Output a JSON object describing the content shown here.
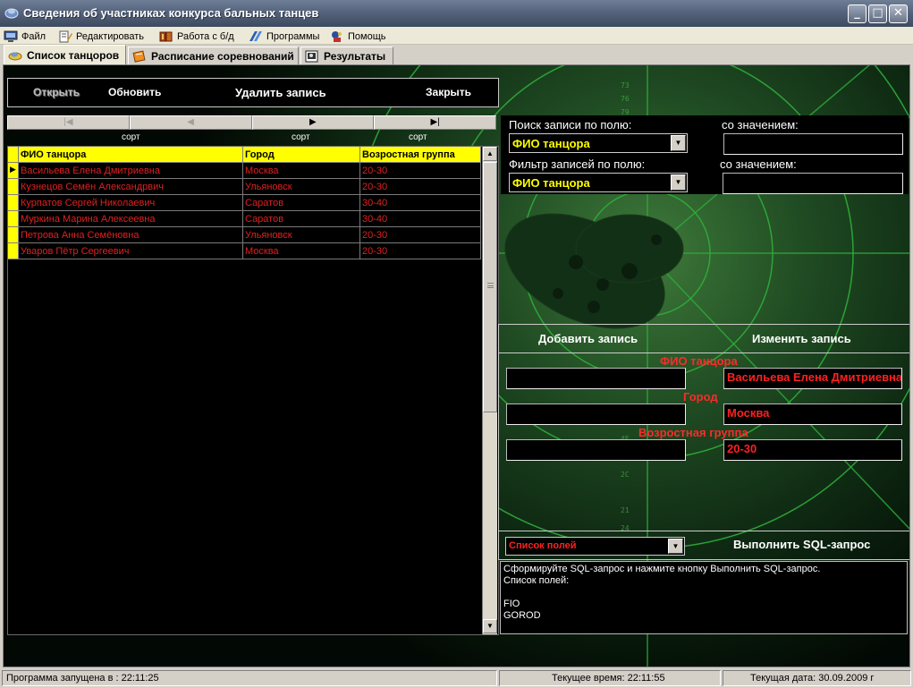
{
  "window": {
    "title": "Сведения об участниках конкурса бальных танцев",
    "minimize_label": "_",
    "maximize_label": "□",
    "close_label": "✕"
  },
  "menu": [
    {
      "label": "Файл",
      "icon": "computer-icon"
    },
    {
      "label": "Редактировать",
      "icon": "edit-icon"
    },
    {
      "label": "Работа с б/д",
      "icon": "database-book-icon"
    },
    {
      "label": "Программы",
      "icon": "programs-icon"
    },
    {
      "label": "Помощь",
      "icon": "help-icon"
    }
  ],
  "tabs": [
    {
      "label": "Список танцоров",
      "icon": "dancers-icon",
      "active": true
    },
    {
      "label": "Расписание соревнований",
      "icon": "schedule-icon",
      "active": false
    },
    {
      "label": "Результаты",
      "icon": "results-icon",
      "active": false
    }
  ],
  "toolbar": {
    "open_label": "Открыть",
    "refresh_label": "Обновить",
    "delete_label": "Удалить запись",
    "close_label": "Закрыть"
  },
  "navigator": {
    "first_label": "|◀",
    "prior_label": "◀",
    "next_label": "▶",
    "last_label": "▶|"
  },
  "sort_labels": [
    "сорт",
    "сорт",
    "сорт"
  ],
  "grid": {
    "columns": [
      "ФИО танцора",
      "Город",
      "Возростная группа"
    ],
    "rows": [
      [
        "Васильева Елена Дмитриевна",
        "Москва",
        "20-30"
      ],
      [
        "Кузнецов Семён Александрвич",
        "Ульяновск",
        "20-30"
      ],
      [
        "Курпатов Сергей Николаевич",
        "Саратов",
        "30-40"
      ],
      [
        "Муркина Марина Алексеевна",
        "Саратов",
        "30-40"
      ],
      [
        "Петрова Анна Семёновна",
        "Ульяновск",
        "20-30"
      ],
      [
        "Уваров Пётр Сергеевич",
        "Москва",
        "20-30"
      ]
    ],
    "current_row_marker": "▶",
    "scroll_up": "▲",
    "scroll_down": "▼"
  },
  "search": {
    "label": "Поиск записи по полю:",
    "value_label": "со значением:",
    "field": "ФИО танцора",
    "value": ""
  },
  "filter": {
    "label": "Фильтр записей по полю:",
    "value_label": "со значением:",
    "field": "ФИО танцора",
    "value": ""
  },
  "editor": {
    "add_label": "Добавить запись",
    "edit_label": "Изменить запись",
    "fields": [
      {
        "label": "ФИО танцора",
        "new_value": "",
        "current_value": "Васильева Елена Дмитриевна"
      },
      {
        "label": "Город",
        "new_value": "",
        "current_value": "Москва"
      },
      {
        "label": "Возростная группа",
        "new_value": "",
        "current_value": "20-30"
      }
    ]
  },
  "sql": {
    "fields_combo": "Список полей",
    "run_label": "Выполнить SQL-запрос",
    "text": "Сформируйте SQL-запрос и нажмите кнопку Выполнить SQL-запрос.\nСписок полей:\n\nFIO\nGOROD"
  },
  "status": {
    "started": "Программа запущена в : 22:11:25",
    "current_time": "Текущее время: 22:11:55",
    "current_date": "Текущая дата: 30.09.2009 г"
  },
  "colors": {
    "header_yellow": "#ffff00",
    "record_red": "#e02020",
    "radar_green": "#2fae3a"
  }
}
